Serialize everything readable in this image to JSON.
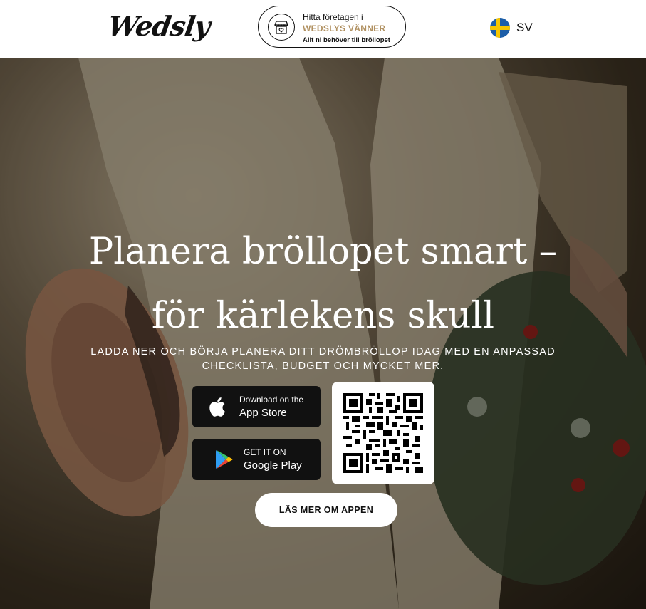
{
  "header": {
    "logo": "Wedsly",
    "vendors": {
      "line1": "Hitta företagen i",
      "line2": "WEDSLYS VÄNNER",
      "line3": "Allt ni behöver till bröllopet",
      "icon": "shop-icon"
    },
    "language": {
      "label": "SV",
      "flag": "swedish-flag"
    }
  },
  "hero": {
    "title": "Planera bröllopet smart – för kärlekens skull",
    "subtitle": "LADDA NER OCH BÖRJA PLANERA DITT DRÖMBRÖLLOP IDAG MED EN ANPASSAD CHECKLISTA, BUDGET OCH MYCKET MER.",
    "app_store": {
      "small": "Download on the",
      "big": "App Store"
    },
    "google_play": {
      "small": "GET IT ON",
      "big": "Google Play"
    },
    "qr_code": "qr-code",
    "more_button": "LÄS MER OM APPEN"
  },
  "colors": {
    "accent_gold": "#b09060",
    "button_dark": "#111111"
  }
}
